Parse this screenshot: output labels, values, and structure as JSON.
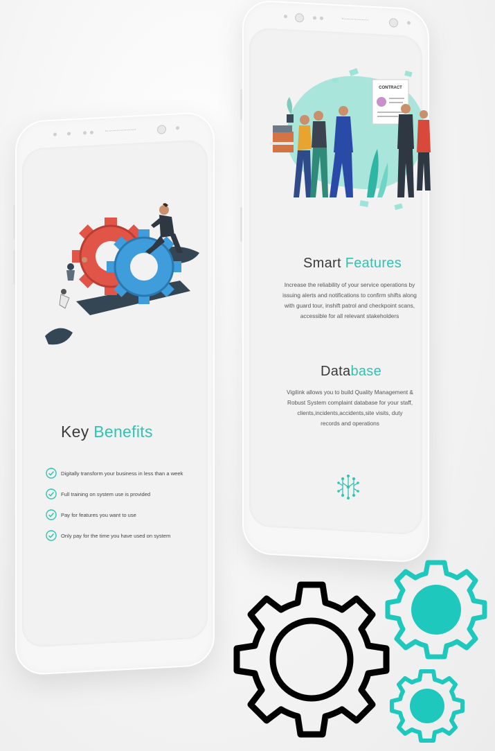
{
  "left_screen": {
    "heading_main": "Key ",
    "heading_accent": "Benefits",
    "benefits": [
      {
        "text": "Digitally transform your business in less than a week",
        "icon": "check-circle-icon"
      },
      {
        "text": "Full training on system use is provided",
        "icon": "check-circle-icon"
      },
      {
        "text": "Pay for features you want to use",
        "icon": "check-circle-icon"
      },
      {
        "text": "Only pay for the time you have used on system",
        "icon": "check-circle-icon"
      }
    ]
  },
  "right_screen": {
    "illustration_label": "CONTRACT",
    "smart_main": "Smart ",
    "smart_accent": "Features",
    "smart_lines": [
      "Increase the reliability of your service operations by",
      "issuing alerts and notifications to confirm shifts along",
      "with guard tour, inshift patrol and checkpoint scans,",
      "accessible for all relevant stakeholders"
    ],
    "db_main": "Data",
    "db_accent": "base",
    "db_lines": [
      "Vigilink allows you to build Quality Management &",
      "Robust System complaint database for your staff,",
      "clients,incidents,accidents,site visits, duty",
      "records and operations"
    ],
    "db_icon": "network-chip-icon"
  },
  "decor": {
    "big_gear_icon": "gear-outline-icon",
    "small_gear_icons": [
      "teal-gear-icon",
      "teal-gear-icon"
    ]
  },
  "colors": {
    "accent": "#2fc3b0",
    "teal_gear": "#1ec8bd",
    "gear_red": "#e05548",
    "gear_blue": "#3f9ddb",
    "dark_text": "#3a3a3a"
  }
}
